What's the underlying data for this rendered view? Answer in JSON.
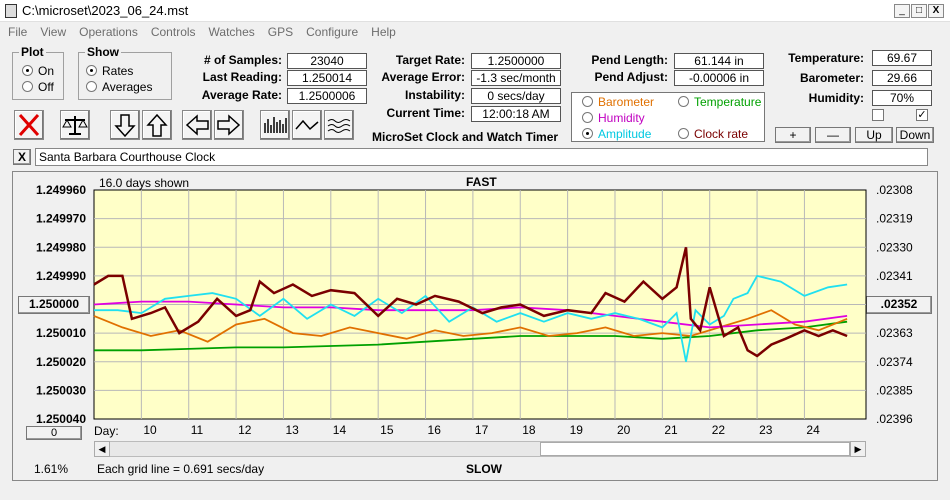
{
  "window": {
    "title": "C:\\microset\\2023_06_24.mst",
    "btn_min": "_",
    "btn_max": "□",
    "btn_close": "X"
  },
  "menu": [
    "File",
    "View",
    "Operations",
    "Controls",
    "Watches",
    "GPS",
    "Configure",
    "Help"
  ],
  "plot_group": {
    "title": "Plot",
    "options": [
      "On",
      "Off"
    ],
    "selected": "On"
  },
  "show_group": {
    "title": "Show",
    "options": [
      "Rates",
      "Averages"
    ],
    "selected": "Rates"
  },
  "stats": {
    "samples_label": "# of Samples:",
    "samples": "23040",
    "last_reading_label": "Last Reading:",
    "last_reading": "1.250014",
    "average_rate_label": "Average Rate:",
    "average_rate": "1.2500006",
    "target_rate_label": "Target Rate:",
    "target_rate": "1.2500000",
    "average_error_label": "Average Error:",
    "average_error": "-1.3 sec/month",
    "instability_label": "Instability:",
    "instability": "0 secs/day",
    "current_time_label": "Current Time:",
    "current_time": "12:00:18 AM",
    "app_caption": "MicroSet Clock and Watch Timer",
    "pend_length_label": "Pend Length:",
    "pend_length": "61.144 in",
    "pend_adjust_label": "Pend Adjust:",
    "pend_adjust": "-0.00006 in",
    "temperature_label": "Temperature:",
    "temperature": "69.67",
    "barometer_label": "Barometer:",
    "barometer": "29.66",
    "humidity_label": "Humidity:",
    "humidity": "70%"
  },
  "series_select": {
    "items": [
      {
        "label": "Barometer",
        "color": "#e07000",
        "selected": false
      },
      {
        "label": "Temperature",
        "color": "#00a000",
        "selected": false
      },
      {
        "label": "Humidity",
        "color": "#c000c0",
        "selected": false
      },
      {
        "label": "Amplitude",
        "color": "#00c8e0",
        "selected": true
      },
      {
        "label": "Clock rate",
        "color": "#7a0000",
        "selected": false
      }
    ]
  },
  "small_buttons": {
    "plus": "+",
    "minus": "—",
    "up": "Up",
    "down": "Down",
    "close_x": "X"
  },
  "checkboxes": {
    "left_checked": false,
    "right_checked": true,
    "right_mark": "✓"
  },
  "clock_name": "Santa Barbara Courthouse Clock",
  "chart_data": {
    "type": "line",
    "top_label": "FAST",
    "bottom_label": "SLOW",
    "days_shown": "16.0 days shown",
    "grid_note": "Each grid line = 0.691 secs/day",
    "zoom": "1.61%",
    "x_axis_label": "Day:",
    "x_ticks": [
      "10",
      "11",
      "12",
      "13",
      "14",
      "15",
      "16",
      "17",
      "18",
      "19",
      "20",
      "21",
      "22",
      "23",
      "24"
    ],
    "xlim": [
      9.0,
      25.3
    ],
    "left_ticks": [
      "1.249960",
      "1.249970",
      "1.249980",
      "1.249990",
      "1.250000",
      "1.250010",
      "1.250020",
      "1.250030",
      "1.250040"
    ],
    "left_selected": "1.250000",
    "right_ticks": [
      ".02308",
      ".02319",
      ".02330",
      ".02341",
      ".02352",
      ".02363",
      ".02374",
      ".02385",
      ".02396"
    ],
    "right_selected": ".02352",
    "bottom_button": "0",
    "ylim": [
      1.25004,
      1.24996
    ],
    "grid": true,
    "series": [
      {
        "color": "#00a000",
        "points": [
          [
            9.0,
            1.250016
          ],
          [
            10,
            1.250016
          ],
          [
            11,
            1.2500155
          ],
          [
            12,
            1.250015
          ],
          [
            13,
            1.250015
          ],
          [
            14,
            1.2500145
          ],
          [
            15,
            1.250014
          ],
          [
            16,
            1.250013
          ],
          [
            17,
            1.250012
          ],
          [
            18,
            1.250011
          ],
          [
            19,
            1.250011
          ],
          [
            20,
            1.250011
          ],
          [
            21,
            1.250012
          ],
          [
            22,
            1.250011
          ],
          [
            23,
            1.250009
          ],
          [
            24,
            1.250008
          ],
          [
            24.9,
            1.250006
          ]
        ]
      },
      {
        "color": "#e07000",
        "points": [
          [
            9.0,
            1.250004
          ],
          [
            9.6,
            1.250008
          ],
          [
            10.2,
            1.250011
          ],
          [
            10.8,
            1.250009
          ],
          [
            11.4,
            1.250013
          ],
          [
            12,
            1.250007
          ],
          [
            12.6,
            1.250005
          ],
          [
            13.2,
            1.25001
          ],
          [
            13.8,
            1.250011
          ],
          [
            14.4,
            1.250008
          ],
          [
            15,
            1.25001
          ],
          [
            15.6,
            1.250012
          ],
          [
            16.2,
            1.250009
          ],
          [
            16.8,
            1.250011
          ],
          [
            17.4,
            1.25001
          ],
          [
            18,
            1.250008
          ],
          [
            18.6,
            1.250011
          ],
          [
            19.2,
            1.25001
          ],
          [
            19.8,
            1.250008
          ],
          [
            20.4,
            1.250011
          ],
          [
            21,
            1.25001
          ],
          [
            21.6,
            1.250011
          ],
          [
            22.2,
            1.250008
          ],
          [
            22.8,
            1.250005
          ],
          [
            23.3,
            1.250002
          ],
          [
            23.8,
            1.250007
          ],
          [
            24.3,
            1.250009
          ],
          [
            24.9,
            1.250005
          ]
        ]
      },
      {
        "color": "#e000e0",
        "points": [
          [
            9.0,
            1.25
          ],
          [
            10,
            1.249999
          ],
          [
            11,
            1.249999
          ],
          [
            12,
            1.25
          ],
          [
            13,
            1.250001
          ],
          [
            14,
            1.250001
          ],
          [
            15,
            1.250002
          ],
          [
            16,
            1.250002
          ],
          [
            17,
            1.250002
          ],
          [
            18,
            1.250001
          ],
          [
            19,
            1.250002
          ],
          [
            20,
            1.250004
          ],
          [
            21,
            1.250006
          ],
          [
            22,
            1.250008
          ],
          [
            23,
            1.250007
          ],
          [
            24,
            1.250006
          ],
          [
            24.9,
            1.250004
          ]
        ]
      },
      {
        "color": "#20e0f0",
        "points": [
          [
            9.0,
            1.250002
          ],
          [
            9.5,
            1.250002
          ],
          [
            10,
            1.250003
          ],
          [
            10.5,
            1.249998
          ],
          [
            11,
            1.249997
          ],
          [
            11.5,
            1.249996
          ],
          [
            12,
            1.249998
          ],
          [
            12.5,
            1.250004
          ],
          [
            13,
            1.249998
          ],
          [
            13.5,
            1.250005
          ],
          [
            14,
            1.25
          ],
          [
            14.5,
            1.250004
          ],
          [
            15,
            1.249998
          ],
          [
            15.5,
            1.250003
          ],
          [
            16,
            1.249997
          ],
          [
            16.5,
            1.250006
          ],
          [
            17,
            1.250001
          ],
          [
            17.5,
            1.250006
          ],
          [
            18,
            1.250003
          ],
          [
            18.5,
            1.250006
          ],
          [
            19,
            1.250003
          ],
          [
            19.5,
            1.250005
          ],
          [
            20,
            1.250003
          ],
          [
            20.5,
            1.250005
          ],
          [
            21,
            1.250008
          ],
          [
            21.3,
            1.250003
          ],
          [
            21.5,
            1.25002
          ],
          [
            21.7,
            1.250002
          ],
          [
            22,
            1.250007
          ],
          [
            22.3,
            1.250004
          ],
          [
            22.5,
            1.249998
          ],
          [
            22.8,
            1.249996
          ],
          [
            23,
            1.24999
          ],
          [
            23.5,
            1.249992
          ],
          [
            24,
            1.249997
          ],
          [
            24.5,
            1.249994
          ],
          [
            24.9,
            1.249993
          ]
        ]
      },
      {
        "color": "#7a0000",
        "points": [
          [
            9.0,
            1.249993
          ],
          [
            9.3,
            1.24999
          ],
          [
            9.6,
            1.24999
          ],
          [
            9.8,
            1.250005
          ],
          [
            10.2,
            1.250003
          ],
          [
            10.5,
            1.250001
          ],
          [
            10.8,
            1.25001
          ],
          [
            11.2,
            1.250006
          ],
          [
            11.6,
            1.249998
          ],
          [
            12,
            1.250004
          ],
          [
            12.3,
            1.250002
          ],
          [
            12.5,
            1.249992
          ],
          [
            12.8,
            1.249996
          ],
          [
            13.2,
            1.249993
          ],
          [
            13.6,
            1.249997
          ],
          [
            14,
            1.249995
          ],
          [
            14.5,
            1.249996
          ],
          [
            15,
            1.250004
          ],
          [
            15.4,
            1.249998
          ],
          [
            15.8,
            1.25
          ],
          [
            16.2,
            1.249997
          ],
          [
            16.7,
            1.249999
          ],
          [
            17.2,
            1.250003
          ],
          [
            17.6,
            1.250001
          ],
          [
            18,
            1.25
          ],
          [
            18.5,
            1.250004
          ],
          [
            19,
            1.250002
          ],
          [
            19.5,
            1.250003
          ],
          [
            19.8,
            1.249996
          ],
          [
            20.2,
            1.249999
          ],
          [
            20.6,
            1.249992
          ],
          [
            21.0,
            1.249998
          ],
          [
            21.3,
            1.249994
          ],
          [
            21.5,
            1.24998
          ],
          [
            21.6,
            1.250005
          ],
          [
            21.8,
            1.250009
          ],
          [
            22.0,
            1.249994
          ],
          [
            22.3,
            1.250011
          ],
          [
            22.6,
            1.250008
          ],
          [
            22.8,
            1.250016
          ],
          [
            23.0,
            1.250018
          ],
          [
            23.3,
            1.250014
          ],
          [
            23.6,
            1.250012
          ],
          [
            24.0,
            1.250009
          ],
          [
            24.3,
            1.250011
          ],
          [
            24.6,
            1.250009
          ],
          [
            24.9,
            1.250011
          ]
        ]
      }
    ]
  }
}
